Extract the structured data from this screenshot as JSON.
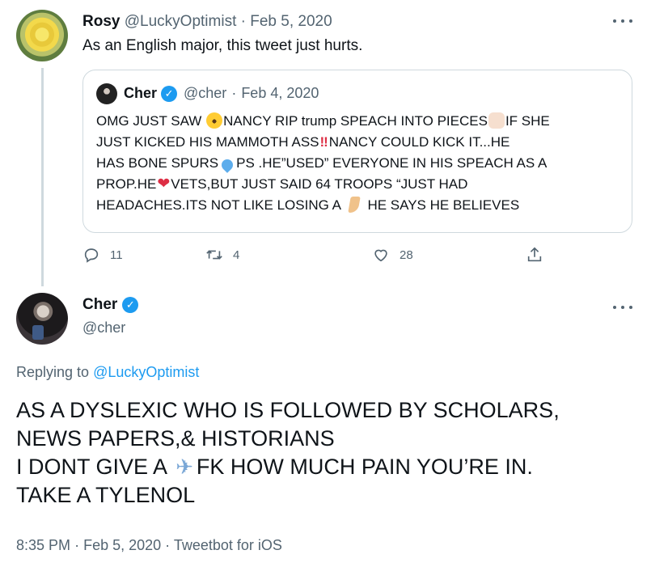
{
  "reply_parent": {
    "author_name": "Rosy",
    "author_handle": "@LuckyOptimist",
    "date": "Feb 5, 2020",
    "text": "As an English major, this tweet just hurts.",
    "actions": {
      "replies": "11",
      "retweets": "4",
      "likes": "28"
    }
  },
  "quoted_tweet": {
    "author_name": "Cher",
    "author_handle": "@cher",
    "date": "Feb 4, 2020",
    "lines": [
      [
        "OMG JUST SAW ",
        "NANCY RIP trump SPEACH INTO PIECES",
        "IF SHE"
      ],
      [
        "JUST KICKED HIS MAMMOTH ASS",
        "NANCY COULD KICK IT...HE"
      ],
      [
        "HAS BONE SPURS",
        "PS .HE”USED” EVERYONE IN HIS SPEACH AS A"
      ],
      [
        "PROP.HE",
        "VETS,BUT JUST SAID 64  TROOPS “JUST HAD"
      ],
      [
        "HEADACHES.ITS NOT LIKE LOSING A ",
        " HE SAYS HE BELIEVES"
      ]
    ],
    "emoji_bang": "‼",
    "emoji_heart": "❤"
  },
  "main_tweet": {
    "author_name": "Cher",
    "author_handle": "@cher",
    "replying_prefix": "Replying to",
    "replying_to": "@LuckyOptimist",
    "lines": [
      "AS A DYSLEXIC WHO IS FOLLOWED BY SCHOLARS,",
      "NEWS PAPERS,& HISTORIANS",
      [
        "I DONT GIVE A ",
        "FK HOW MUCH PAIN YOU’RE IN."
      ],
      "TAKE A TYLENOL"
    ],
    "emoji_plane": "✈",
    "time": "8:35 PM",
    "date": "Feb 5, 2020",
    "client": "Tweetbot for iOS"
  },
  "separator": "·",
  "verified_glyph": "✓",
  "colors": {
    "accent": "#1d9bf0",
    "muted": "#536471",
    "text": "#0f1419",
    "border": "#cfd9de"
  },
  "icons": [
    "more-icon",
    "verified-icon",
    "reply-icon",
    "retweet-icon",
    "like-icon",
    "share-icon"
  ]
}
